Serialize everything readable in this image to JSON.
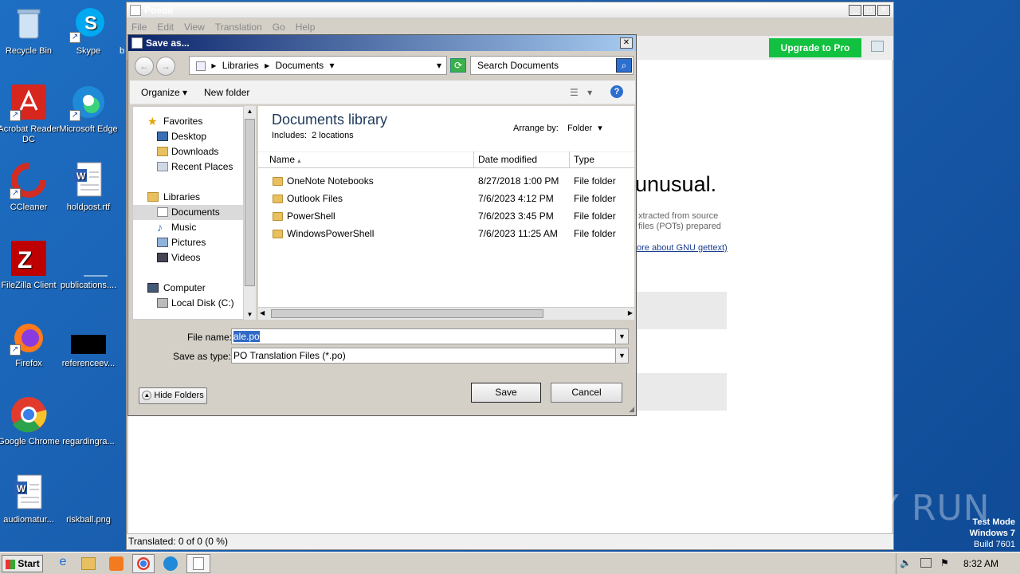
{
  "desktop": {
    "icons": [
      {
        "label": "Recycle Bin",
        "icon": "recycle-bin-icon"
      },
      {
        "label": "Skype",
        "icon": "skype-icon"
      },
      {
        "label": "Acrobat Reader DC",
        "icon": "acrobat-icon"
      },
      {
        "label": "Microsoft Edge",
        "icon": "edge-icon"
      },
      {
        "label": "CCleaner",
        "icon": "ccleaner-icon"
      },
      {
        "label": "holdpost.rtf",
        "icon": "word-doc-icon"
      },
      {
        "label": "FileZilla Client",
        "icon": "filezilla-icon"
      },
      {
        "label": "publications....",
        "icon": "blank-file-icon"
      },
      {
        "label": "Firefox",
        "icon": "firefox-icon"
      },
      {
        "label": "referenceev...",
        "icon": "black-file-icon"
      },
      {
        "label": "Google Chrome",
        "icon": "chrome-icon"
      },
      {
        "label": "regardingra...",
        "icon": "blank-file-icon"
      },
      {
        "label": "audiomatur...",
        "icon": "word-doc-icon"
      },
      {
        "label": "riskball.png",
        "icon": "blank-file-icon"
      }
    ],
    "partial_icon_label": "b"
  },
  "poedit": {
    "title": "Poedit",
    "menu": [
      "File",
      "Edit",
      "View",
      "Translation",
      "Go",
      "Help"
    ],
    "upgrade_label": "Upgrade to Pro",
    "heading_fragment": "unusual.",
    "text_line1": "xtracted from source",
    "text_line2": "files (POTs) prepared",
    "link_text": "ore about GNU gettext)",
    "status": "Translated: 0 of 0 (0 %)"
  },
  "dialog": {
    "title": "Save as...",
    "breadcrumb": [
      "Libraries",
      "Documents"
    ],
    "search_placeholder": "Search Documents",
    "toolbar": {
      "organize": "Organize",
      "new_folder": "New folder"
    },
    "nav": {
      "favorites": "Favorites",
      "desktop": "Desktop",
      "downloads": "Downloads",
      "recent": "Recent Places",
      "libraries": "Libraries",
      "documents": "Documents",
      "music": "Music",
      "pictures": "Pictures",
      "videos": "Videos",
      "computer": "Computer",
      "localdisk": "Local Disk (C:)"
    },
    "library_title": "Documents library",
    "includes": "Includes:",
    "locations": "2 locations",
    "arrange_by_label": "Arrange by:",
    "arrange_by_value": "Folder",
    "columns": {
      "name": "Name",
      "date": "Date modified",
      "type": "Type"
    },
    "files": [
      {
        "name": "OneNote Notebooks",
        "date": "8/27/2018 1:00 PM",
        "type": "File folder"
      },
      {
        "name": "Outlook Files",
        "date": "7/6/2023 4:12 PM",
        "type": "File folder"
      },
      {
        "name": "PowerShell",
        "date": "7/6/2023 3:45 PM",
        "type": "File folder"
      },
      {
        "name": "WindowsPowerShell",
        "date": "7/6/2023 11:25 AM",
        "type": "File folder"
      }
    ],
    "file_name_label": "File name:",
    "file_name_value": "ale.po",
    "save_type_label": "Save as type:",
    "save_type_value": "PO Translation Files (*.po)",
    "hide_folders": "Hide Folders",
    "save": "Save",
    "cancel": "Cancel"
  },
  "taskbar": {
    "start": "Start",
    "time": "8:32 AM"
  },
  "watermark": {
    "brand": "ANY RUN",
    "line1": "Test Mode",
    "line2": "Windows 7",
    "line3": "Build 7601"
  }
}
